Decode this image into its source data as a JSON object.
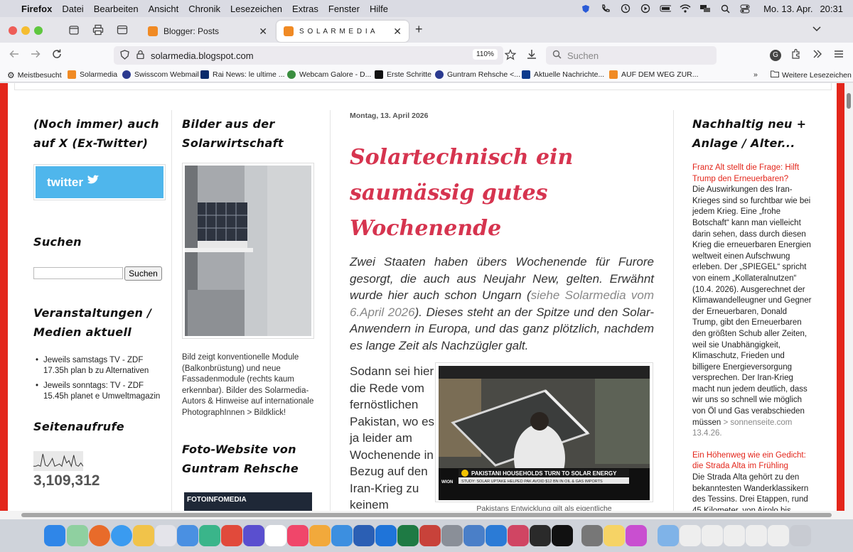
{
  "menubar": {
    "app": "Firefox",
    "items": [
      "Datei",
      "Bearbeiten",
      "Ansicht",
      "Chronik",
      "Lesezeichen",
      "Extras",
      "Fenster",
      "Hilfe"
    ],
    "date": "Mo. 13. Apr.",
    "time": "20:31"
  },
  "tabs": [
    {
      "title": "Blogger: Posts"
    },
    {
      "title": "S O L A R M E D I A"
    }
  ],
  "navbar": {
    "url": "solarmedia.blogspot.com",
    "zoom": "110%",
    "search_placeholder": "Suchen"
  },
  "bookmarks": {
    "items": [
      "Meistbesucht",
      "Solarmedia",
      "Swisscom Webmail",
      "Rai News: le ultime ...",
      "Webcam Galore - D...",
      "Erste Schritte",
      "Guntram Rehsche <...",
      "Aktuelle Nachrichte...",
      "AUF DEM WEG ZUR..."
    ],
    "more": "Weitere Lesezeichen"
  },
  "left_col": {
    "twitter_heading": "(Noch immer) auch auf X (Ex-Twitter)",
    "twitter_button": "twitter",
    "search_heading": "Suchen",
    "search_button": "Suchen",
    "events_heading": "Veranstaltungen / Medien aktuell",
    "events": [
      "Jeweils samstags TV - ZDF 17.35h plan b zu Alternativen",
      "Jeweils sonntags: TV - ZDF 15.45h planet e Umweltmagazin"
    ],
    "pageviews_heading": "Seitenaufrufe",
    "pageviews_count": "3,109,312",
    "sparkline": [
      3,
      3,
      4,
      3,
      14,
      4,
      3,
      6,
      10,
      3,
      4,
      5,
      3,
      12,
      6,
      8,
      3,
      13,
      4,
      3,
      6,
      3
    ]
  },
  "mid_col": {
    "pictures_heading": "Bilder aus der Solarwirtschaft",
    "picture_caption": "Bild zeigt konventionelle Module (Balkonbrüstung) und neue Fassadenmodule (rechts kaum erkennbar). Bilder des Solarmedia-Autors & Hinweise auf internationale PhotographInnen > Bildklick!",
    "photo_heading": "Foto-Website von Guntram Rehsche",
    "photo_banner": "FOTOINFOMEDIA"
  },
  "post": {
    "date": "Montag, 13. April 2026",
    "title": "Solartechnisch ein saumässig gutes Wochenende",
    "lead_a": "Zwei Staaten haben übers Wochenende für Furore gesorgt, die auch aus Neujahr New, gelten. Erwähnt wurde hier auch schon Ungarn (",
    "lead_link": "siehe Solarmedia vom 6.April 2026",
    "lead_b": "). Dieses steht an der Spitze und den Solar-Anwendern in Europa, und das ganz plötzlich, nachdem es lange Zeit als Nachzügler galt.",
    "body": "Sodann sei hier die Rede vom fernöstlichen Pakistan, wo es ja leider am Wochenende in Bezug auf den Iran-Krieg zu keinem",
    "image_headline": "PAKISTANI HOUSEHOLDS TURN TO SOLAR ENERGY",
    "image_ticker": "STUDY: SOLAR UPTAKE HELPED PAK AVOID $12 BN IN OIL & GAS IMPORTS",
    "image_logo": "WION",
    "image_caption": "Pakistans Entwicklung gilt als eigentliche"
  },
  "right_col": {
    "heading": "Nachhaltig neu + Anlage / Alter...",
    "item1_title": "Franz Alt stellt die Frage: Hilft Trump den Erneuerbaren?",
    "item1_body": "Die Auswirkungen des Iran-Krieges sind so furchtbar wie bei jedem Krieg. Eine „frohe Botschaft“ kann man vielleicht darin sehen, dass durch diesen Krieg die erneuerbaren Energien weltweit einen Aufschwung erleben. Der „SPIEGEL“ spricht von einem „Kollateralnutzen“ (10.4. 2026). Ausgerechnet der Klimawandelleugner und Gegner der Erneuerbaren, Donald Trump, gibt den Erneuerbaren den größten Schub aller Zeiten, weil sie Unabhängigkeit, Klimaschutz, Frieden und billigere Energieversorgung versprechen. Der Iran-Krieg macht nun jedem deutlich, dass wir uns so schnell wie möglich von Öl und Gas verabschieden müssen",
    "item1_source": " > sonnenseite.com 13.4.26.",
    "item2_title": "Ein Höhenweg wie ein Gedicht: die Strada Alta im Frühling",
    "item2_body": "Die Strada Alta gehört zu den bekanntesten Wanderklassikern des Tessins. Drei Etappen, rund 45 Kilometer, von Airolo bis Biasca. Die..."
  },
  "colors": {
    "accent_red": "#e3261b",
    "title_pink": "#d6344f",
    "twitter_blue": "#4fb6ec"
  }
}
